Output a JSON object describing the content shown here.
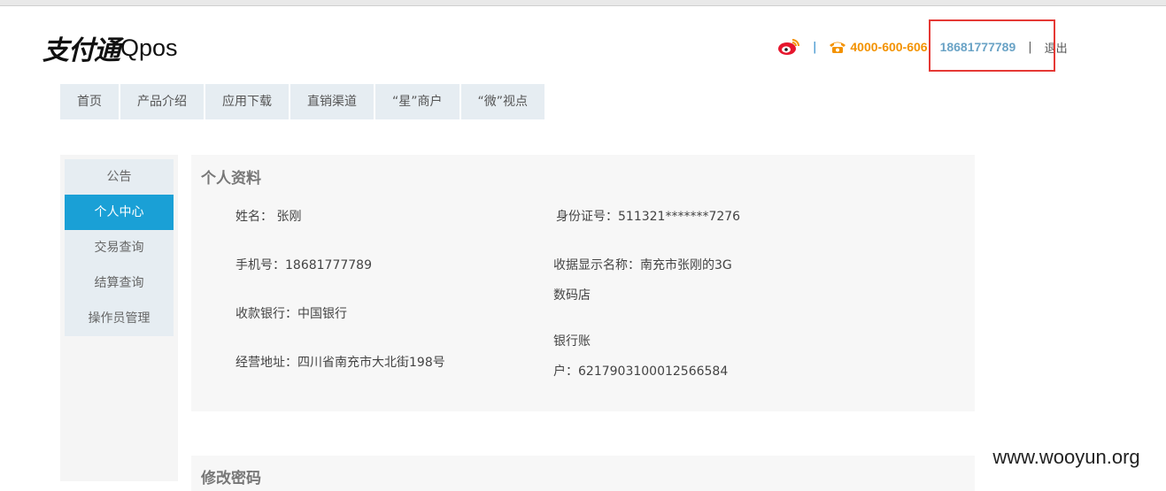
{
  "header": {
    "logo_cn": "支付通",
    "logo_en": "Qpos",
    "hotline": "4000-600-606",
    "user_phone": "18681777789",
    "separator": "|",
    "logout": "退出",
    "weibo_icon": "weibo-icon",
    "phone_icon": "telephone-icon"
  },
  "nav": [
    "首页",
    "产品介绍",
    "应用下载",
    "直销渠道",
    "“星”商户",
    "“微”视点"
  ],
  "sidebar": {
    "items": [
      "公告",
      "个人中心",
      "交易查询",
      "结算查询",
      "操作员管理"
    ],
    "active": "个人中心"
  },
  "profile": {
    "title": "个人资料",
    "name": "姓名： 张刚",
    "id_card": "身份证号：511321*******7276",
    "mobile": "手机号：18681777789",
    "receipt_name_1": "收据显示名称：南充市张刚的3G",
    "receipt_name_2": "数码店",
    "bank": "收款银行：中国银行",
    "account_1": "银行账",
    "account_2": "户：6217903100012566584",
    "address": "经营地址：四川省南充市大北街198号"
  },
  "password": {
    "title": "修改密码"
  },
  "watermark": "www.wooyun.org",
  "colors": {
    "accent": "#1aa0d6",
    "hotline": "#f39200",
    "user": "#6aa3c6",
    "highlight_box": "#e53935"
  }
}
